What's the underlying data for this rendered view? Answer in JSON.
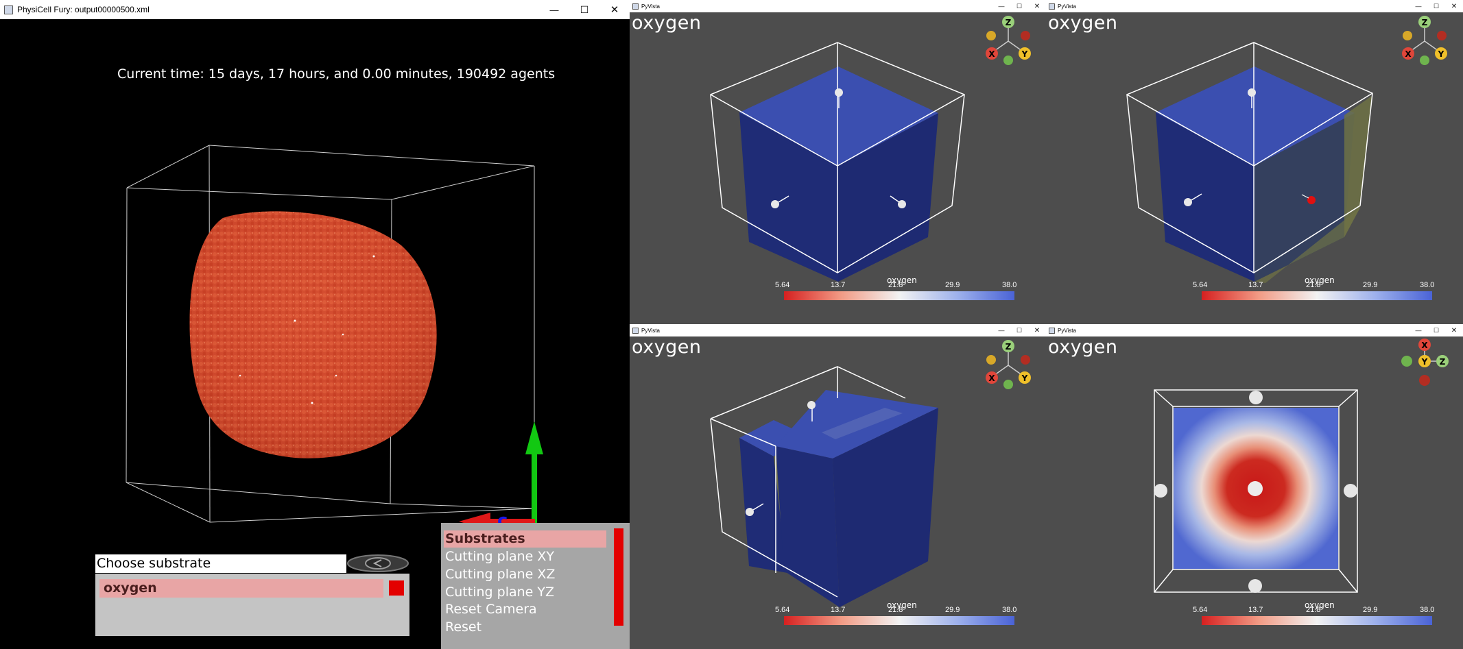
{
  "main_window": {
    "title": "PhysiCell Fury: output00000500.xml",
    "status_text": "Current time: 15 days, 17 hours, and 0.00 minutes, 190492 agents",
    "substrate_label": "Choose substrate",
    "substrate_selected": "oxygen",
    "menu_items": [
      "Substrates",
      "Cutting plane XY",
      "Cutting plane XZ",
      "Cutting plane YZ",
      "Reset Camera",
      "Reset"
    ],
    "menu_active": "Substrates",
    "controls": {
      "minimize": "—",
      "maximize": "☐",
      "close": "✕"
    }
  },
  "pyvista_windows": [
    {
      "title": "PyVista",
      "label": "oxygen",
      "scalar_title": "oxygen",
      "ticks": [
        "5.64",
        "13.7",
        "21.8",
        "29.9",
        "38.0"
      ]
    },
    {
      "title": "PyVista",
      "label": "oxygen",
      "scalar_title": "oxygen",
      "ticks": [
        "5.64",
        "13.7",
        "21.8",
        "29.9",
        "38.0"
      ]
    },
    {
      "title": "PyVista",
      "label": "oxygen",
      "scalar_title": "oxygen",
      "ticks": [
        "5.64",
        "13.7",
        "21.8",
        "29.9",
        "38.0"
      ]
    },
    {
      "title": "PyVista",
      "label": "oxygen",
      "scalar_title": "oxygen",
      "ticks": [
        "5.64",
        "13.7",
        "21.8",
        "29.9",
        "38.0"
      ]
    }
  ],
  "axes_widget": {
    "x": "X",
    "y": "Y",
    "z": "Z"
  },
  "pyvista_controls": {
    "minimize": "—",
    "maximize": "☐",
    "close": "✕"
  },
  "colors": {
    "cell_color": "#d3492d",
    "scalar_high": "#4a63d6",
    "scalar_low": "#d62020",
    "viewport_gray": "#4d4d4d",
    "axis_x": "#e0463a",
    "axis_y": "#f0c02a",
    "axis_z": "#9ad07a"
  }
}
